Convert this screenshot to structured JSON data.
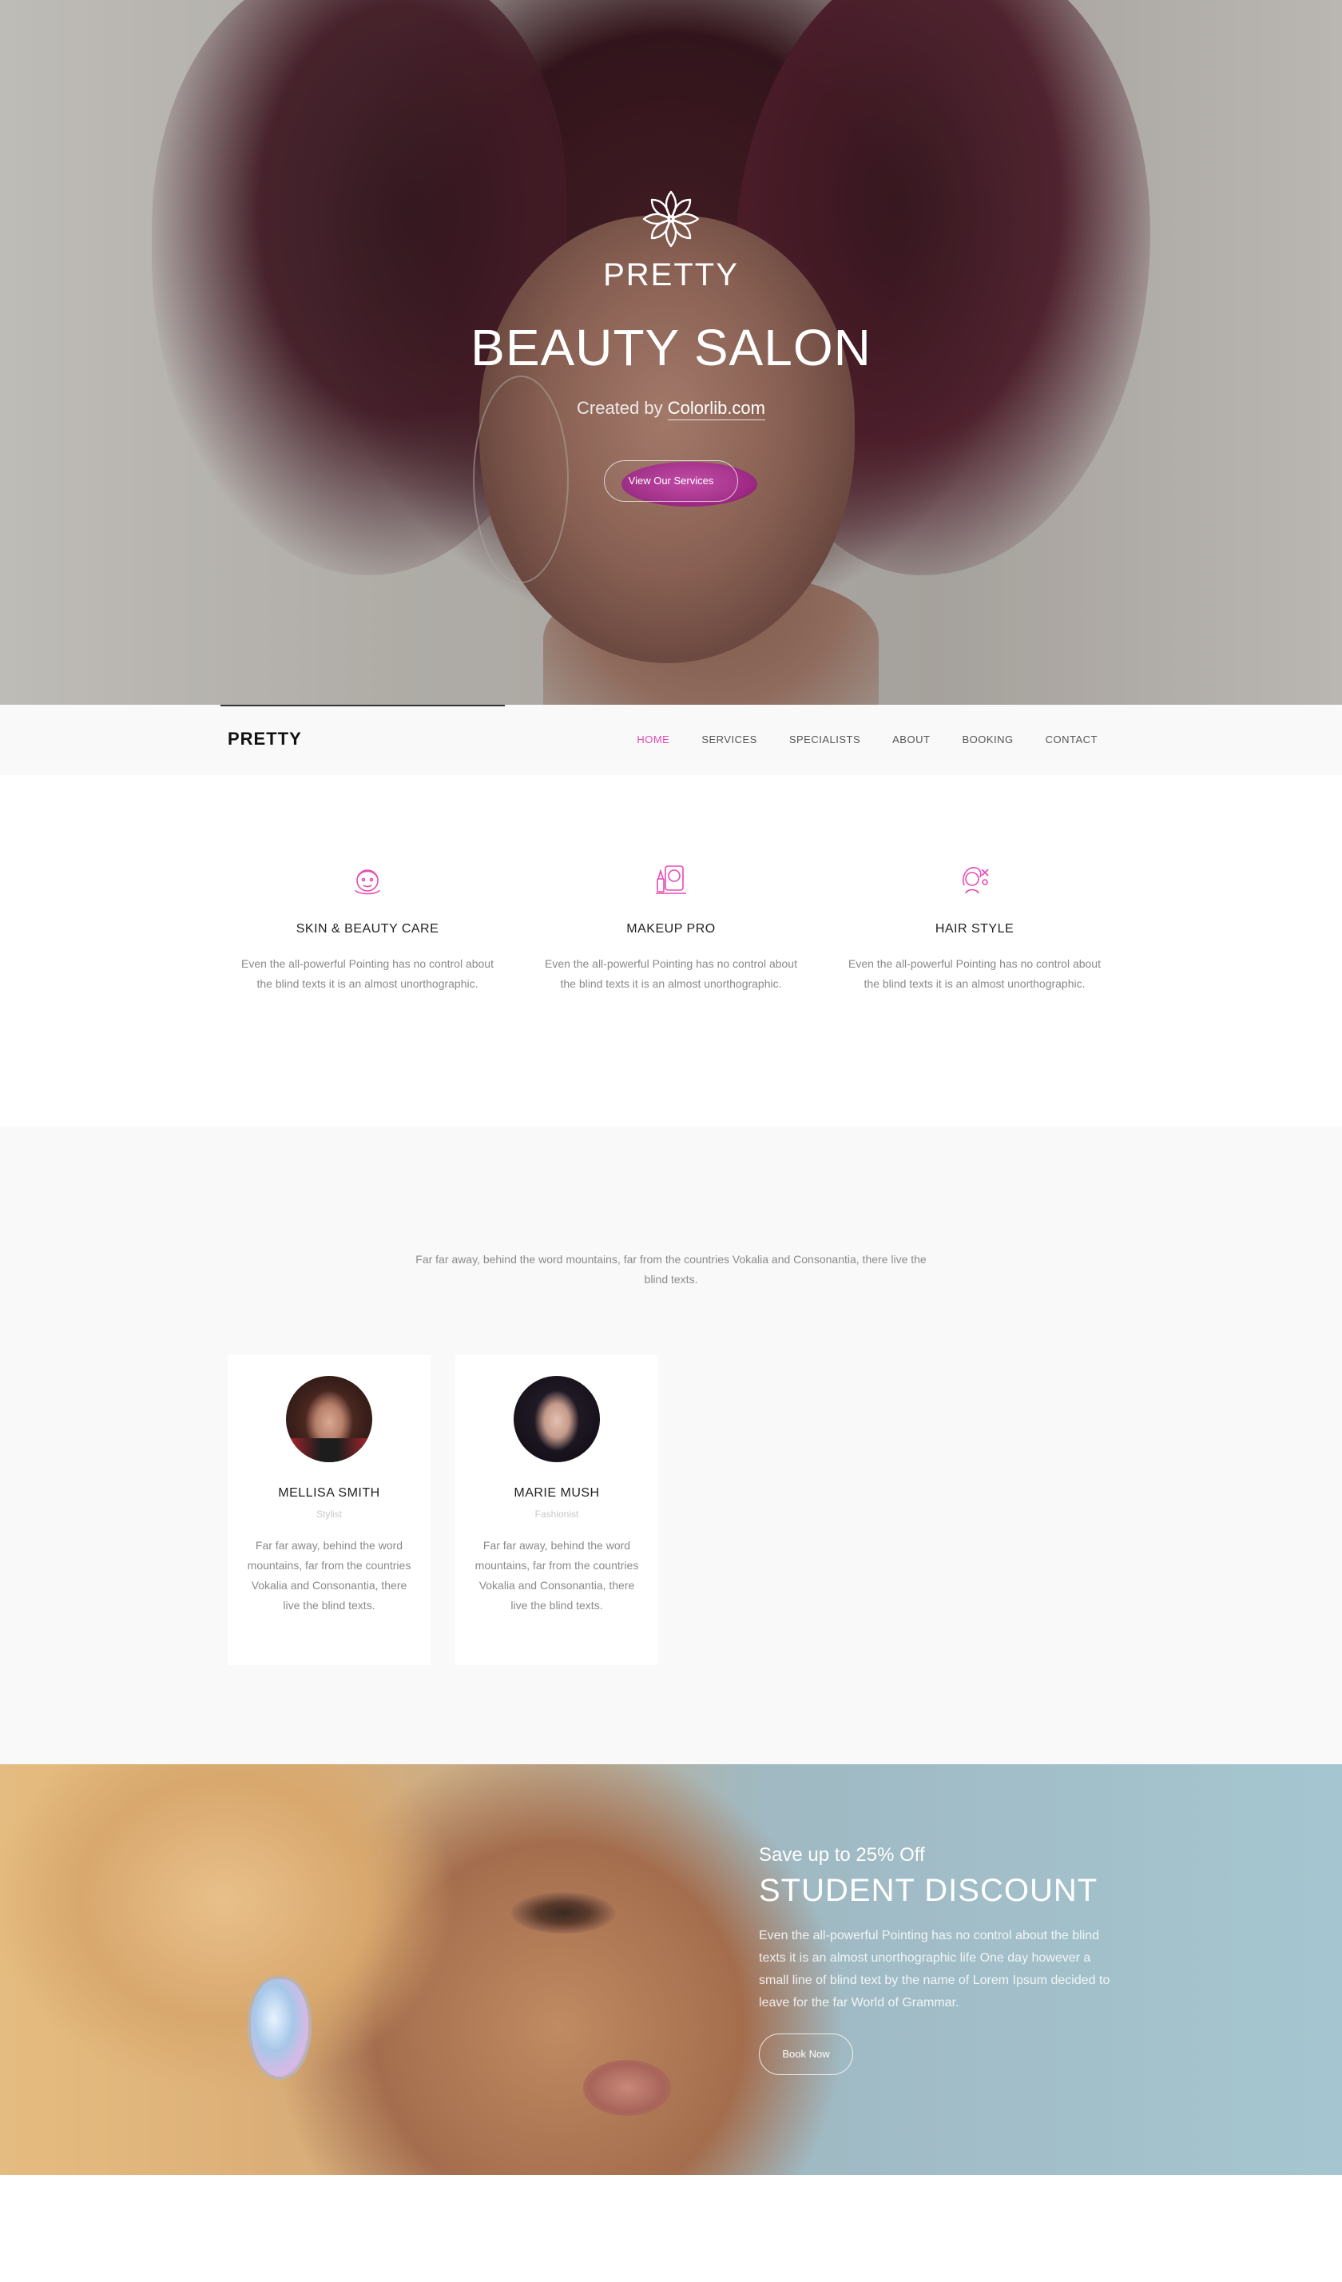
{
  "hero": {
    "brand": "PRETTY",
    "title": "BEAUTY SALON",
    "subtitle_prefix": "Created by ",
    "subtitle_link": "Colorlib.com",
    "cta": "View Our Services",
    "logo_icon": "lotus-icon"
  },
  "nav": {
    "brand": "PRETTY",
    "items": [
      "HOME",
      "SERVICES",
      "SPECIALISTS",
      "ABOUT",
      "BOOKING",
      "CONTACT"
    ],
    "active_index": 0,
    "accent_color": "#e64bb3"
  },
  "services": [
    {
      "icon": "face-care-icon",
      "title": "SKIN & BEAUTY CARE",
      "text": "Even the all-powerful Pointing has no control about the blind texts it is an almost unorthographic."
    },
    {
      "icon": "makeup-icon",
      "title": "MAKEUP PRO",
      "text": "Even the all-powerful Pointing has no control about the blind texts it is an almost unorthographic."
    },
    {
      "icon": "hair-style-icon",
      "title": "HAIR STYLE",
      "text": "Even the all-powerful Pointing has no control about the blind texts it is an almost unorthographic."
    }
  ],
  "specialists": {
    "intro": "Far far away, behind the word mountains, far from the countries Vokalia and Consonantia, there live the blind texts.",
    "people": [
      {
        "name": "MELLISA SMITH",
        "role": "Stylist",
        "text": "Far far away, behind the word mountains, far from the countries Vokalia and Consonantia, there live the blind texts."
      },
      {
        "name": "MARIE MUSH",
        "role": "Fashionist",
        "text": "Far far away, behind the word mountains, far from the countries Vokalia and Consonantia, there live the blind texts."
      }
    ]
  },
  "promo": {
    "kicker": "Save up to 25% Off",
    "title": "STUDENT DISCOUNT",
    "text": "Even the all-powerful Pointing has no control about the blind texts it is an almost unorthographic life One day however a small line of blind text by the name of Lorem Ipsum decided to leave for the far World of Grammar.",
    "cta": "Book Now"
  },
  "colors": {
    "accent": "#e64bb3",
    "promo_bg": "#a5c6d0",
    "section_bg": "#f9f9f9"
  }
}
